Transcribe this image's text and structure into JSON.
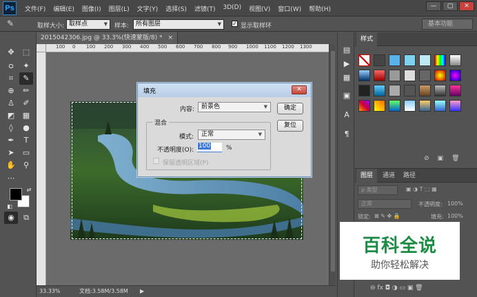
{
  "app": {
    "logo": "Ps"
  },
  "menu": [
    "文件(F)",
    "编辑(E)",
    "图像(I)",
    "图层(L)",
    "文字(Y)",
    "选择(S)",
    "滤镜(T)",
    "3D(D)",
    "视图(V)",
    "窗口(W)",
    "帮助(H)"
  ],
  "window_controls": {
    "minimize": "—",
    "restore": "▢",
    "close": "✕"
  },
  "options": {
    "sample_size_label": "取样大小:",
    "sample_size_value": "取样点",
    "sample_label": "样本:",
    "sample_value": "所有图层",
    "show_ring_label": "显示取样环",
    "show_ring_checked": true,
    "workspace": "基本功能"
  },
  "document": {
    "tab_title": "2015042306.jpg @ 33.3%(快速蒙版/8) *",
    "tab_close": "×",
    "ruler_ticks": [
      "100",
      "0",
      "100",
      "200",
      "300",
      "400",
      "500",
      "600",
      "700",
      "800",
      "900",
      "1000",
      "1100",
      "1200",
      "1300"
    ],
    "zoom": "33.33%",
    "doc_info": "文档:3.58M/3.58M"
  },
  "panels": {
    "styles_tab": "样式",
    "layers_tabs": [
      "图层",
      "通道",
      "路径"
    ],
    "layers_filter": "ρ 类型",
    "blend_mode": "正常",
    "opacity_label": "不透明度:",
    "opacity_value": "100%",
    "lock_label": "锁定:",
    "fill_label": "填充:",
    "fill_value": "100%"
  },
  "dialog": {
    "title": "填充",
    "close": "✕",
    "content_label": "内容:",
    "content_value": "前景色",
    "ok": "确定",
    "reset": "复位",
    "blending_legend": "混合",
    "mode_label": "模式:",
    "mode_value": "正常",
    "opacity_label": "不透明度(O):",
    "opacity_value": "100",
    "opacity_unit": "%",
    "preserve_label": "保留透明区域(P)",
    "preserve_checked": false
  },
  "watermark": {
    "title": "百科全说",
    "subtitle": "助你轻松解决"
  },
  "colors": {
    "foreground": "#000000",
    "background": "#ffffff",
    "accent": "#1c8c44"
  }
}
